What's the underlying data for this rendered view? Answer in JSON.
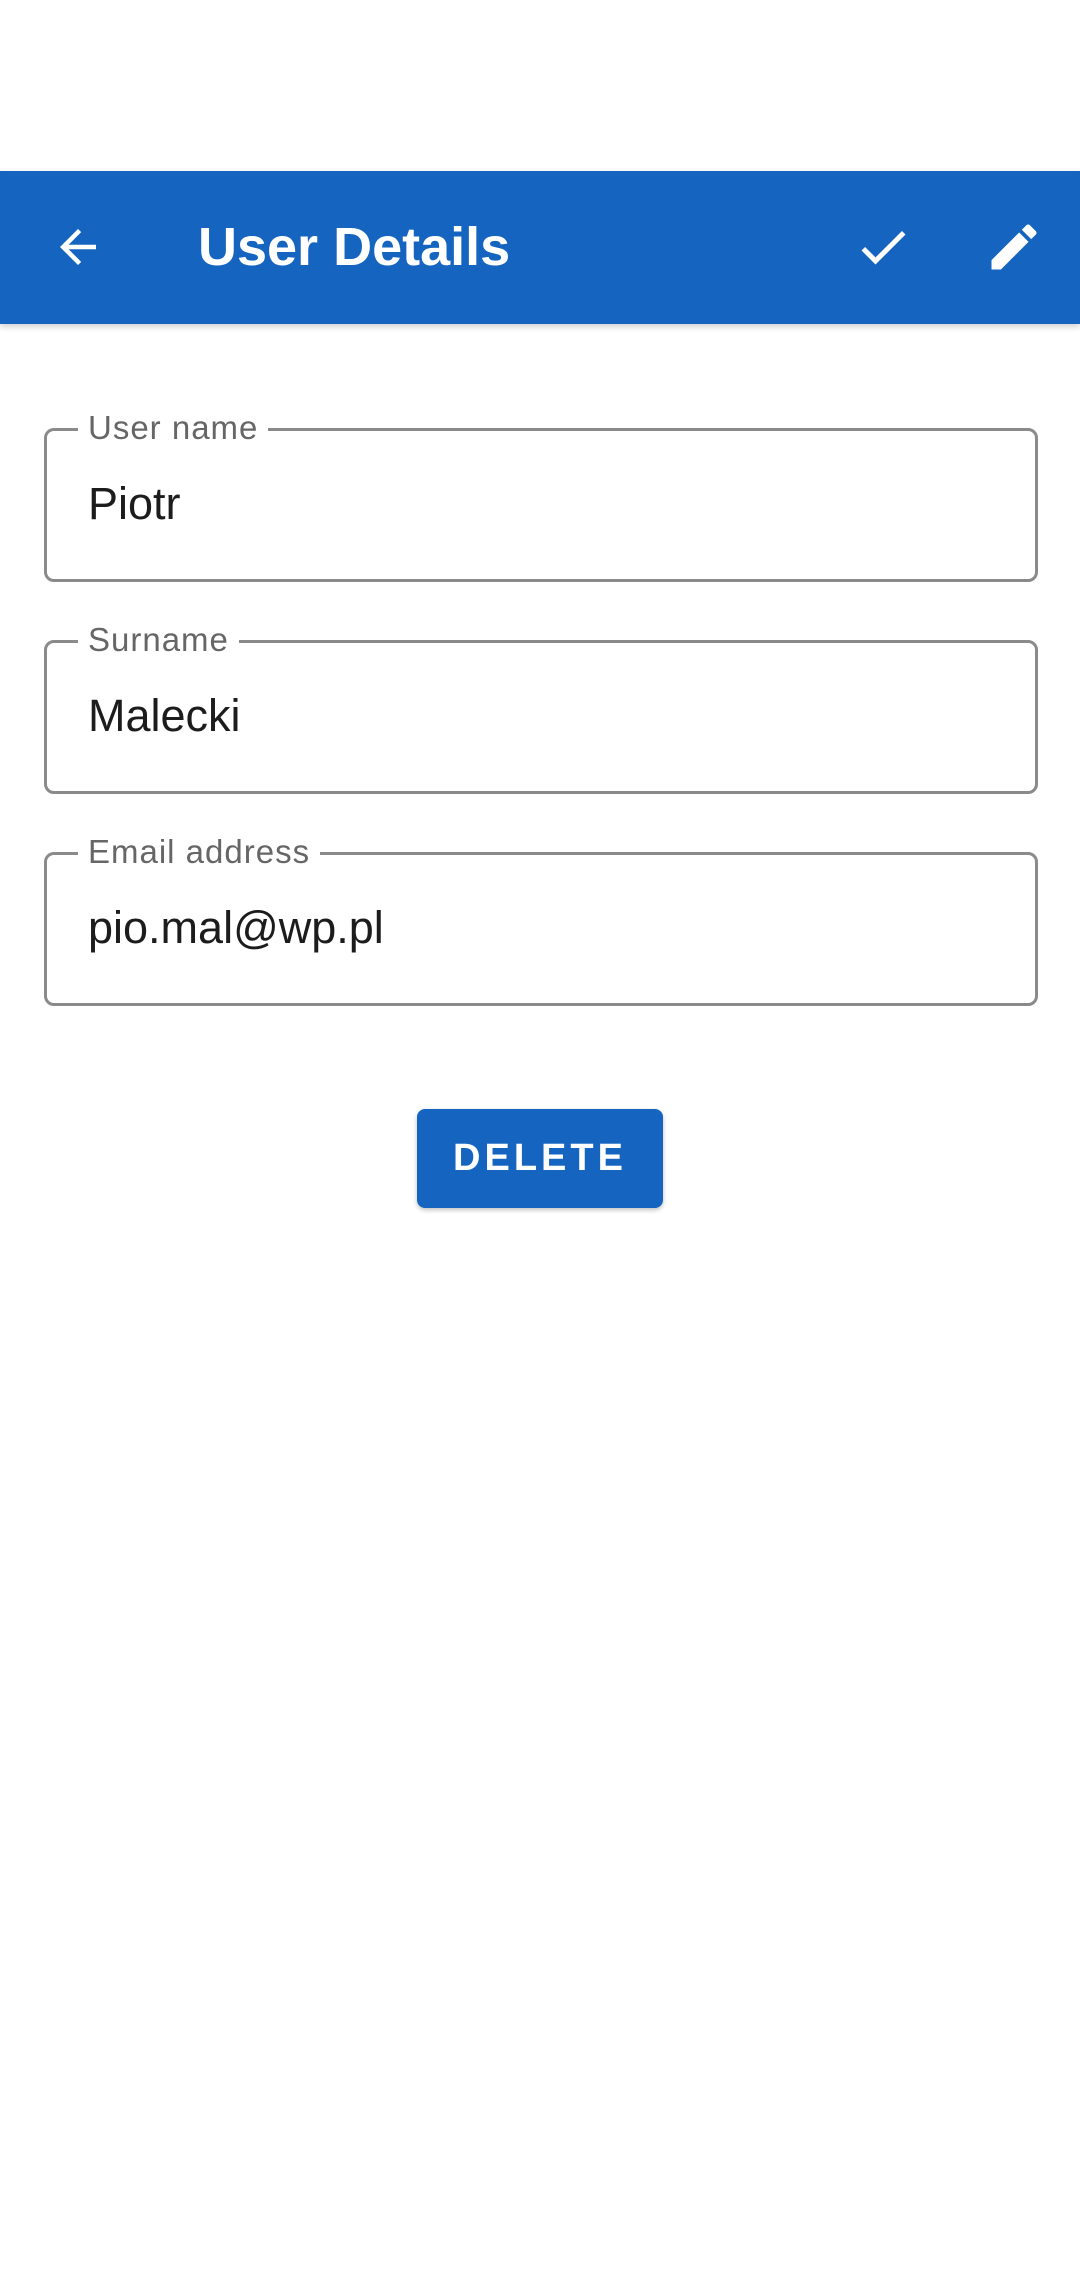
{
  "app_bar": {
    "title": "User Details",
    "back_icon": "arrow-back-icon",
    "actions": [
      {
        "icon": "check-icon"
      },
      {
        "icon": "pencil-edit-icon"
      }
    ],
    "background_color": "#1565c0"
  },
  "form": {
    "user_name": {
      "label": "User name",
      "value": "Piotr"
    },
    "surname": {
      "label": "Surname",
      "value": "Malecki"
    },
    "email": {
      "label": "Email address",
      "value": "pio.mal@wp.pl"
    }
  },
  "delete_button": {
    "label": "DELETE",
    "color": "#1565c0"
  }
}
